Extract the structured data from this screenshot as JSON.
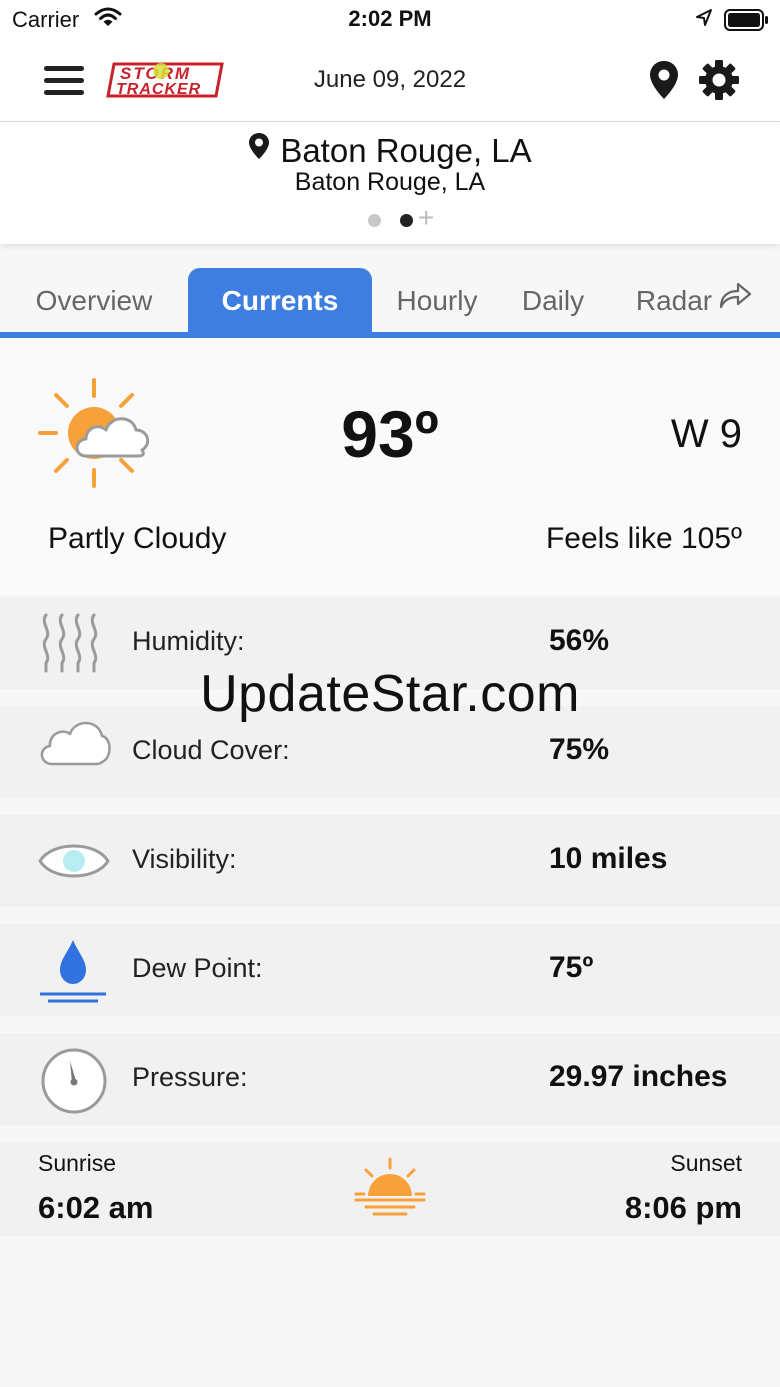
{
  "status_bar": {
    "carrier": "Carrier",
    "time": "2:02 PM"
  },
  "nav": {
    "date": "June 09, 2022",
    "logo_text": [
      "STORM",
      "TRACKER"
    ]
  },
  "location": {
    "title": "Baton Rouge, LA",
    "subtitle": "Baton Rouge, LA",
    "page_dots": 2,
    "active_dot": 2
  },
  "tabs": [
    {
      "label": "Overview",
      "active": false
    },
    {
      "label": "Currents",
      "active": true
    },
    {
      "label": "Hourly",
      "active": false
    },
    {
      "label": "Daily",
      "active": false
    },
    {
      "label": "Radar",
      "active": false
    }
  ],
  "current": {
    "temperature": "93º",
    "wind": "W 9",
    "condition": "Partly Cloudy",
    "feels_like": "Feels like 105º",
    "icon": "partly-cloudy-icon"
  },
  "details": [
    {
      "label": "Humidity:",
      "value": "56%",
      "icon": "humidity-icon"
    },
    {
      "label": "Cloud Cover:",
      "value": "75%",
      "icon": "cloud-icon"
    },
    {
      "label": "Visibility:",
      "value": "10 miles",
      "icon": "eye-icon"
    },
    {
      "label": "Dew Point:",
      "value": "75º",
      "icon": "water-drop-icon"
    },
    {
      "label": "Pressure:",
      "value": "29.97 inches",
      "icon": "gauge-icon"
    }
  ],
  "sun": {
    "sunrise_label": "Sunrise",
    "sunrise_time": "6:02 am",
    "sunset_label": "Sunset",
    "sunset_time": "8:06 pm"
  },
  "watermark": "UpdateStar.com",
  "colors": {
    "accent": "#3d7ee0",
    "sun": "#f6a13a",
    "drop": "#2f72e0"
  }
}
